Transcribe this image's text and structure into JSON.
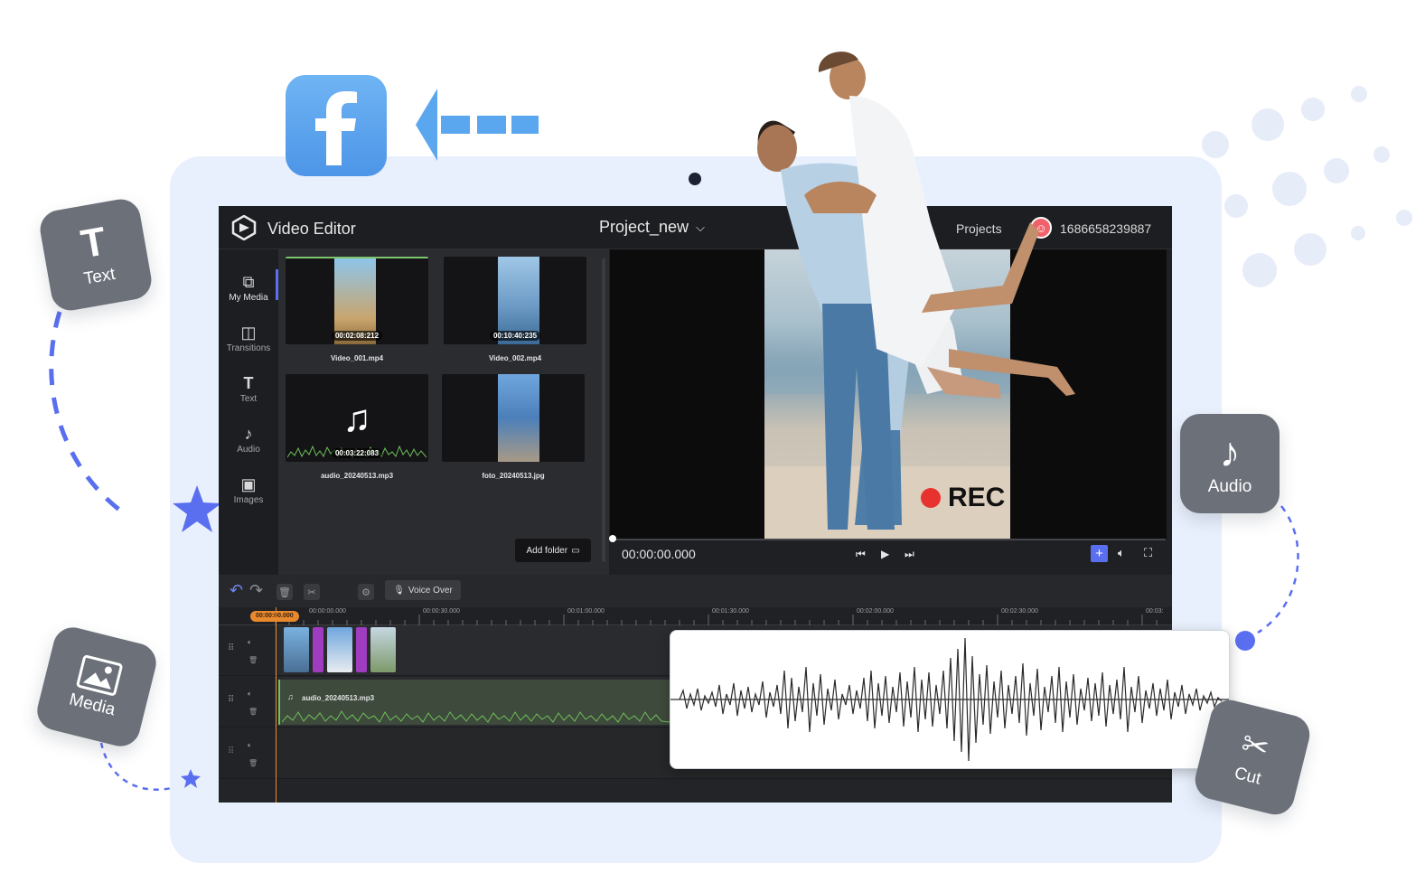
{
  "app": {
    "title": "Video Editor",
    "project_name": "Project_new",
    "projects_label": "Projects",
    "user_id": "1686658239887"
  },
  "sidebar": {
    "items": [
      {
        "label": "My Media",
        "icon": "media-icon"
      },
      {
        "label": "Transitions",
        "icon": "transitions-icon"
      },
      {
        "label": "Text",
        "icon": "text-icon"
      },
      {
        "label": "Audio",
        "icon": "audio-icon"
      },
      {
        "label": "Images",
        "icon": "images-icon"
      }
    ]
  },
  "media": {
    "items": [
      {
        "name": "Video_001.mp4",
        "duration": "00:02:08:212"
      },
      {
        "name": "Video_002.mp4",
        "duration": "00:10:40:235"
      },
      {
        "name": "audio_20240513.mp3",
        "duration": "00:03:22:083"
      },
      {
        "name": "foto_20240513.jpg",
        "duration": ""
      }
    ],
    "add_folder": "Add folder"
  },
  "preview": {
    "time": "00:00:00.000",
    "rec_label": "REC"
  },
  "timeline": {
    "voice_over": "Voice Over",
    "playhead": "00:00:00.000",
    "ruler": [
      "00:00:00.000",
      "00:00:30.000",
      "00:01:00.000",
      "00:01:30.000",
      "00:02:00.000",
      "00:02:30.000",
      "00:03:"
    ],
    "audio_clip": "audio_20240513.mp3"
  },
  "floating": {
    "text": "Text",
    "media": "Media",
    "audio": "Audio",
    "cut": "Cut"
  },
  "colors": {
    "accent": "#5a6ff0",
    "frame": "#e9f0fd",
    "tile": "#6b7079",
    "facebook": "#4d95e8",
    "rec": "#e8322e",
    "playhead": "#e8892e"
  }
}
